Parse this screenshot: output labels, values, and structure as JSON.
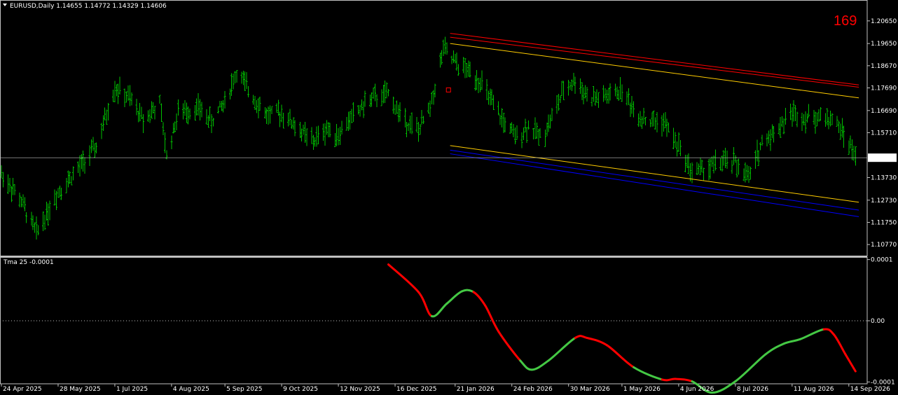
{
  "header": {
    "title": "EURUSD,Daily  1.14655 1.14772 1.14329 1.14606",
    "counter": "169"
  },
  "colors": {
    "background": "#000000",
    "frame": "#c0c0c0",
    "bars": "#00c000",
    "upper_red": "#ff0000",
    "upper_yellow": "#ffcc00",
    "lower_yellow": "#ffcc00",
    "lower_blue": "#0000ff",
    "osc_up": "#44c844",
    "osc_down": "#ff0000"
  },
  "chart_data": [
    {
      "type": "ohlc",
      "symbol": "EURUSD",
      "timeframe": "Daily",
      "ohlc_header": {
        "open": 1.14655,
        "high": 1.14772,
        "low": 1.14329,
        "close": 1.14606
      },
      "ylim": [
        1.1028,
        1.2114
      ],
      "y_ticks": [
        "1.20650",
        "1.19650",
        "1.18670",
        "1.17690",
        "1.16690",
        "1.15710",
        "1.14606",
        "1.13730",
        "1.12730",
        "1.11750",
        "1.10770"
      ],
      "current_price": 1.14606,
      "current_price_label": "1.14606",
      "x_labels": [
        "24 Apr 2025",
        "28 May 2025",
        "1 Jul 2025",
        "4 Aug 2025",
        "5 Sep 2025",
        "9 Oct 2025",
        "12 Nov 2025",
        "16 Dec 2025",
        "21 Jan 2026",
        "24 Feb 2026",
        "30 Mar 2026",
        "1 May 2026",
        "4 Jun 2026",
        "8 Jul 2026",
        "11 Aug 2026",
        "14 Sep 2026"
      ],
      "x_range": [
        "2025-04-24",
        "2026-09-25"
      ],
      "price_path": [
        [
          "2025-04-24",
          1.139
        ],
        [
          "2025-05-05",
          1.128
        ],
        [
          "2025-05-15",
          1.113
        ],
        [
          "2025-05-28",
          1.131
        ],
        [
          "2025-06-10",
          1.142
        ],
        [
          "2025-06-20",
          1.151
        ],
        [
          "2025-07-01",
          1.177
        ],
        [
          "2025-07-10",
          1.172
        ],
        [
          "2025-07-18",
          1.163
        ],
        [
          "2025-07-28",
          1.17
        ],
        [
          "2025-08-01",
          1.147
        ],
        [
          "2025-08-08",
          1.166
        ],
        [
          "2025-08-20",
          1.168
        ],
        [
          "2025-08-28",
          1.162
        ],
        [
          "2025-09-05",
          1.171
        ],
        [
          "2025-09-12",
          1.184
        ],
        [
          "2025-09-20",
          1.175
        ],
        [
          "2025-09-30",
          1.165
        ],
        [
          "2025-10-09",
          1.166
        ],
        [
          "2025-10-20",
          1.158
        ],
        [
          "2025-10-28",
          1.153
        ],
        [
          "2025-11-05",
          1.159
        ],
        [
          "2025-11-12",
          1.156
        ],
        [
          "2025-11-20",
          1.164
        ],
        [
          "2025-12-01",
          1.172
        ],
        [
          "2025-12-12",
          1.174
        ],
        [
          "2025-12-20",
          1.164
        ],
        [
          "2025-12-30",
          1.158
        ],
        [
          "2026-01-06",
          1.168
        ],
        [
          "2026-01-14",
          1.194
        ],
        [
          "2026-01-22",
          1.187
        ],
        [
          "2026-01-30",
          1.184
        ],
        [
          "2026-02-05",
          1.18
        ],
        [
          "2026-02-12",
          1.17
        ],
        [
          "2026-02-18",
          1.163
        ],
        [
          "2026-02-26",
          1.155
        ],
        [
          "2026-03-06",
          1.16
        ],
        [
          "2026-03-14",
          1.155
        ],
        [
          "2026-03-20",
          1.164
        ],
        [
          "2026-03-28",
          1.177
        ],
        [
          "2026-04-03",
          1.18
        ],
        [
          "2026-04-12",
          1.172
        ],
        [
          "2026-04-22",
          1.173
        ],
        [
          "2026-05-01",
          1.176
        ],
        [
          "2026-05-10",
          1.165
        ],
        [
          "2026-05-18",
          1.162
        ],
        [
          "2026-05-26",
          1.162
        ],
        [
          "2026-06-04",
          1.151
        ],
        [
          "2026-06-12",
          1.14
        ],
        [
          "2026-06-20",
          1.141
        ],
        [
          "2026-06-28",
          1.144
        ],
        [
          "2026-07-08",
          1.144
        ],
        [
          "2026-07-16",
          1.137
        ],
        [
          "2026-07-24",
          1.153
        ],
        [
          "2026-08-01",
          1.158
        ],
        [
          "2026-08-11",
          1.166
        ],
        [
          "2026-08-18",
          1.164
        ],
        [
          "2026-08-26",
          1.164
        ],
        [
          "2026-09-05",
          1.163
        ],
        [
          "2026-09-12",
          1.155
        ],
        [
          "2026-09-18",
          1.147
        ]
      ],
      "channels": [
        {
          "color": "#ff0000",
          "from": [
            "2026-01-18",
            1.201
          ],
          "to": [
            "2026-09-20",
            1.1782
          ]
        },
        {
          "color": "#ff0000",
          "from": [
            "2026-01-18",
            1.1993
          ],
          "to": [
            "2026-09-20",
            1.1772
          ]
        },
        {
          "color": "#ffcc00",
          "from": [
            "2026-01-18",
            1.1965
          ],
          "to": [
            "2026-09-20",
            1.1725
          ]
        },
        {
          "color": "#ffcc00",
          "from": [
            "2026-01-18",
            1.1514
          ],
          "to": [
            "2026-09-20",
            1.1264
          ]
        },
        {
          "color": "#0000ff",
          "from": [
            "2026-01-18",
            1.1494
          ],
          "to": [
            "2026-09-20",
            1.1229
          ]
        },
        {
          "color": "#0000ff",
          "from": [
            "2026-01-18",
            1.1478
          ],
          "to": [
            "2026-09-20",
            1.12
          ]
        }
      ],
      "marker": {
        "date": "2026-01-17",
        "price": 1.176
      }
    },
    {
      "type": "line",
      "name": "Tma 25 -0.0001",
      "label": "Tma 25 -0.0001",
      "ylim": [
        -0.000103,
        0.000103
      ],
      "y_ticks": [
        "0.0001",
        "0.00",
        "-0.0001"
      ],
      "zero_line": true,
      "points": [
        [
          "2025-12-12",
          9.2e-05
        ],
        [
          "2025-12-30",
          4.7e-05
        ],
        [
          "2026-01-07",
          7.5e-06
        ],
        [
          "2026-01-16",
          2.8e-05
        ],
        [
          "2026-01-25",
          4.8e-05
        ],
        [
          "2026-02-01",
          4.7e-05
        ],
        [
          "2026-02-08",
          2.5e-05
        ],
        [
          "2026-02-16",
          -1.75e-05
        ],
        [
          "2026-03-01",
          -6.5e-05
        ],
        [
          "2026-03-08",
          -8e-05
        ],
        [
          "2026-03-18",
          -6.5e-05
        ],
        [
          "2026-04-03",
          -2.8e-05
        ],
        [
          "2026-04-10",
          -2.8e-05
        ],
        [
          "2026-04-22",
          -4e-05
        ],
        [
          "2026-05-08",
          -7.6e-05
        ],
        [
          "2026-05-25",
          -9.6e-05
        ],
        [
          "2026-06-02",
          -9.5e-05
        ],
        [
          "2026-06-12",
          -9.9e-05
        ],
        [
          "2026-06-24",
          -0.0001175
        ],
        [
          "2026-07-08",
          -9.9e-05
        ],
        [
          "2026-07-26",
          -5.5e-05
        ],
        [
          "2026-08-06",
          -3.75e-05
        ],
        [
          "2026-08-16",
          -3e-05
        ],
        [
          "2026-08-30",
          -1.4e-05
        ],
        [
          "2026-09-05",
          -2.25e-05
        ],
        [
          "2026-09-12",
          -5.5e-05
        ],
        [
          "2026-09-18",
          -8.25e-05
        ]
      ],
      "colors": [
        "down",
        "down",
        "up",
        "up",
        "up",
        "down",
        "down",
        "down",
        "up",
        "up",
        "up",
        "down",
        "down",
        "down",
        "up",
        "down",
        "down",
        "up",
        "up",
        "up",
        "up",
        "up",
        "up",
        "down",
        "down",
        "down"
      ]
    }
  ]
}
